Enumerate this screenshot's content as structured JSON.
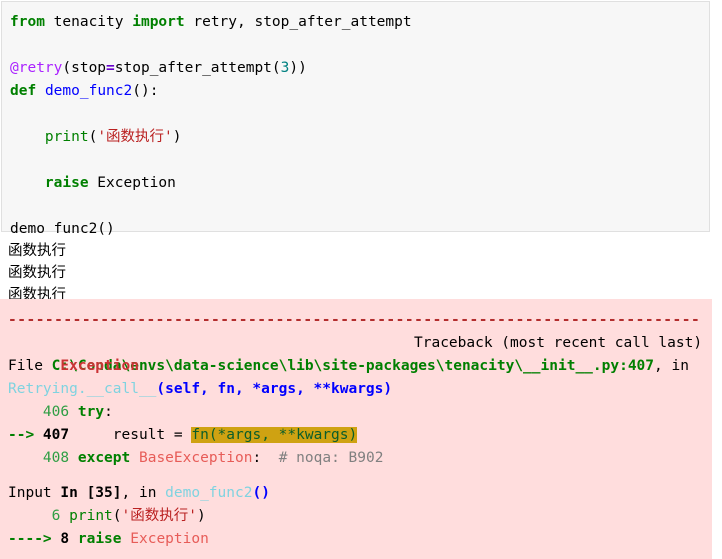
{
  "notebook": {
    "input_cell": {
      "lines": [
        [
          {
            "t": "from",
            "c": "kw"
          },
          {
            "t": " ",
            "c": "plain"
          },
          {
            "t": "tenacity",
            "c": "plain"
          },
          {
            "t": " ",
            "c": "plain"
          },
          {
            "t": "import",
            "c": "kw"
          },
          {
            "t": " retry, stop_after_attempt",
            "c": "plain"
          }
        ],
        [],
        [
          {
            "t": "@retry",
            "c": "deco"
          },
          {
            "t": "(stop",
            "c": "plain"
          },
          {
            "t": "=",
            "c": "op"
          },
          {
            "t": "stop_after_attempt(",
            "c": "plain"
          },
          {
            "t": "3",
            "c": "num"
          },
          {
            "t": "))",
            "c": "plain"
          }
        ],
        [
          {
            "t": "def",
            "c": "kw"
          },
          {
            "t": " ",
            "c": "plain"
          },
          {
            "t": "demo_func2",
            "c": "fn"
          },
          {
            "t": "():",
            "c": "plain"
          }
        ],
        [],
        [
          {
            "t": "    ",
            "c": "plain"
          },
          {
            "t": "print",
            "c": "bi"
          },
          {
            "t": "(",
            "c": "plain"
          },
          {
            "t": "'函数执行'",
            "c": "str"
          },
          {
            "t": ")",
            "c": "plain"
          }
        ],
        [],
        [
          {
            "t": "    ",
            "c": "plain"
          },
          {
            "t": "raise",
            "c": "kw"
          },
          {
            "t": " Exception",
            "c": "plain"
          }
        ],
        [],
        [
          {
            "t": "demo_func2()",
            "c": "plain"
          }
        ]
      ]
    },
    "stdout": {
      "lines": [
        "函数执行",
        "函数执行",
        "函数执行"
      ]
    },
    "traceback": {
      "separator": "---------------------------------------------------------------------------",
      "exception_name": "Exception",
      "traceback_label": "Traceback (most recent call last)",
      "frames": [
        {
          "file_prefix": "File ",
          "file_path": "C:\\Conda\\envs\\data-science\\lib\\site-packages\\tenacity\\__init__.py:407",
          "file_suffix": ", in",
          "scope_name": "Retrying.__call__",
          "scope_args": "(self, fn, *args, **kwargs)",
          "code_lines": [
            {
              "marker": "   ",
              "lineno": "406",
              "segments": [
                {
                  "t": " ",
                  "c": "plain"
                },
                {
                  "t": "try",
                  "c": "kw"
                },
                {
                  "t": ":",
                  "c": "plain"
                }
              ]
            },
            {
              "marker": "-->",
              "lineno": "407",
              "segments": [
                {
                  "t": "     result ",
                  "c": "plain"
                },
                {
                  "t": "=",
                  "c": "plain"
                },
                {
                  "t": " ",
                  "c": "plain"
                },
                {
                  "t": "fn(*args, **kwargs)",
                  "c": "hl"
                }
              ]
            },
            {
              "marker": "   ",
              "lineno": "408",
              "segments": [
                {
                  "t": " ",
                  "c": "plain"
                },
                {
                  "t": "except",
                  "c": "kw"
                },
                {
                  "t": " ",
                  "c": "plain"
                },
                {
                  "t": "BaseException",
                  "c": "exc-red"
                },
                {
                  "t": ":  ",
                  "c": "plain"
                },
                {
                  "t": "# noqa: B902",
                  "c": "cmt"
                }
              ]
            }
          ]
        },
        {
          "file_prefix": "Input ",
          "cell_id": "In [35]",
          "file_suffix": ", in ",
          "scope_name": "demo_func2",
          "scope_args": "()",
          "code_lines": [
            {
              "marker": "    ",
              "lineno": "6",
              "segments": [
                {
                  "t": " ",
                  "c": "plain"
                },
                {
                  "t": "print",
                  "c": "bi"
                },
                {
                  "t": "(",
                  "c": "plain"
                },
                {
                  "t": "'函数执行'",
                  "c": "str"
                },
                {
                  "t": ")",
                  "c": "plain"
                }
              ]
            },
            {
              "marker": "---->",
              "lineno": "8",
              "segments": [
                {
                  "t": " ",
                  "c": "plain"
                },
                {
                  "t": "raise",
                  "c": "kw"
                },
                {
                  "t": " ",
                  "c": "plain"
                },
                {
                  "t": "Exception",
                  "c": "exc-red"
                }
              ]
            }
          ]
        }
      ]
    }
  },
  "colors": {
    "code_cell_bg": "#f7f7f7",
    "code_cell_border": "#e0e0e0",
    "traceback_bg": "#ffdddd",
    "highlight_bg": "#cfa212",
    "keyword": "#008000",
    "string": "#ba2121",
    "decorator": "#aa22ff",
    "function": "#0000ff",
    "number": "#008080",
    "exception": "#cb3335",
    "path": "#007f00",
    "scope": "#7fd3e0",
    "comment": "#808080"
  }
}
